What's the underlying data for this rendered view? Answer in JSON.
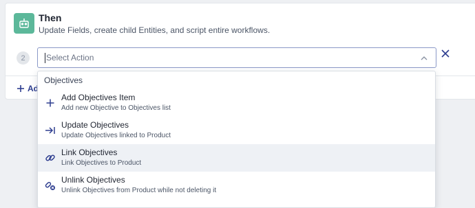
{
  "then_block": {
    "title": "Then",
    "description": "Update Fields, create child Entities, and script entire workflows."
  },
  "action_row": {
    "step_number": "2",
    "placeholder": "Select Action"
  },
  "add_action": {
    "label": "Add"
  },
  "dropdown": {
    "group_label": "Objectives",
    "options": [
      {
        "title": "Add Objectives Item",
        "description": "Add new Objective to Objectives list",
        "icon": "plus-icon"
      },
      {
        "title": "Update Objectives",
        "description": "Update Objectives linked to Product",
        "icon": "arrow-to-line-icon"
      },
      {
        "title": "Link Objectives",
        "description": "Link Objectives to Product",
        "icon": "link-icon"
      },
      {
        "title": "Unlink Objectives",
        "description": "Unlink Objectives from Product while not deleting it",
        "icon": "unlink-icon"
      }
    ]
  },
  "colors": {
    "accent": "#2d3d8f",
    "then_icon_bg": "#5cb89a",
    "hover_row": "#eef1f5",
    "focus_border": "#8a98c7"
  }
}
